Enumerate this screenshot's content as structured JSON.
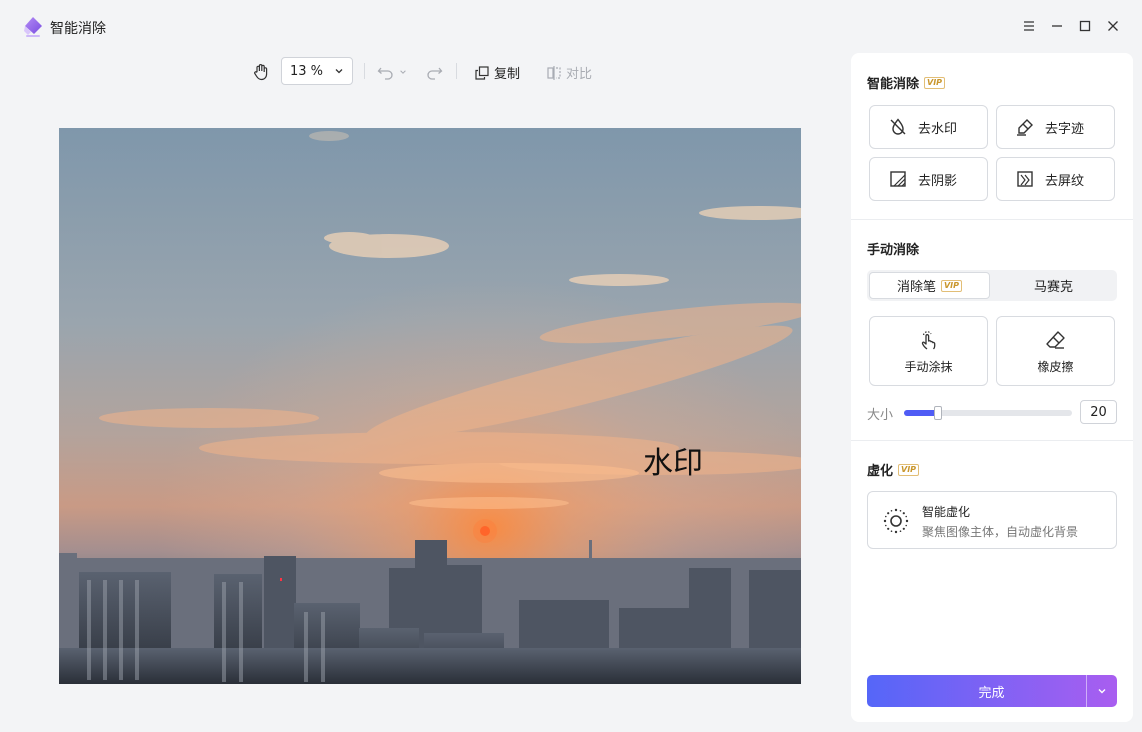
{
  "app": {
    "title": "智能消除"
  },
  "toolbar": {
    "zoom": "13 %",
    "copy_label": "复制",
    "compare_label": "对比"
  },
  "canvas": {
    "watermark_text": "水印"
  },
  "smart_remove": {
    "title": "智能消除",
    "vip": "VIP",
    "tools": [
      "去水印",
      "去字迹",
      "去阴影",
      "去屏纹"
    ]
  },
  "manual_remove": {
    "title": "手动消除",
    "tabs": [
      "消除笔",
      "马赛克"
    ],
    "tab_vip": "VIP",
    "tools": [
      "手动涂抹",
      "橡皮擦"
    ],
    "size_label": "大小",
    "size_value": "20",
    "size_fraction": 0.2
  },
  "blur": {
    "title": "虚化",
    "vip": "VIP",
    "card_title": "智能虚化",
    "card_desc": "聚焦图像主体，自动虚化背景"
  },
  "actions": {
    "done_label": "完成"
  },
  "colors": {
    "accent": "#4f5cf5",
    "accent_end": "#a95ef0",
    "vip": "#c9962c"
  }
}
